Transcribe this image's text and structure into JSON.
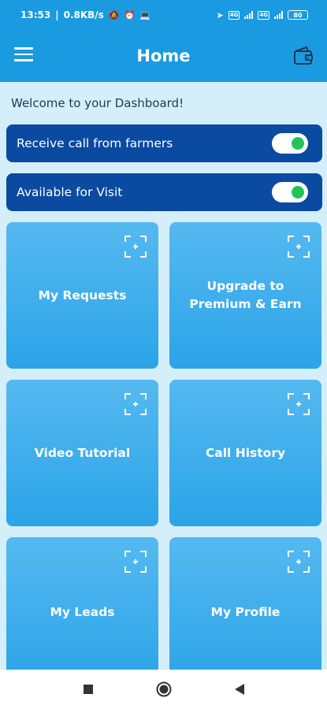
{
  "status_bar": {
    "time": "13:53",
    "speed": "0.8KB/s",
    "sim1": "4G",
    "sim2": "4G",
    "battery": "80"
  },
  "app_bar": {
    "title": "Home",
    "menu_icon": "hamburger-menu-icon",
    "wallet_icon": "wallet-icon"
  },
  "welcome_text": "Welcome to your Dashboard!",
  "toggles": [
    {
      "label": "Receive call from farmers",
      "on": true
    },
    {
      "label": "Available for Visit",
      "on": true
    }
  ],
  "tiles": [
    {
      "label": "My Requests"
    },
    {
      "label": "Upgrade to Premium & Earn"
    },
    {
      "label": "Video Tutorial"
    },
    {
      "label": "Call History"
    },
    {
      "label": "My Leads"
    },
    {
      "label": "My Profile"
    }
  ],
  "colors": {
    "primary": "#1a9ae0",
    "toggle_row": "#0b4aa1",
    "tile": "#2ba4e8",
    "background": "#d4eefa",
    "switch_on": "#22c45a"
  }
}
